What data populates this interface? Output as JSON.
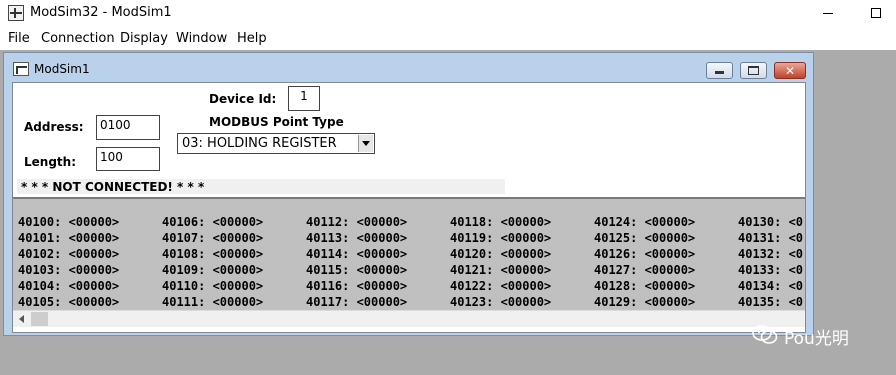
{
  "app": {
    "title": "ModSim32 - ModSim1",
    "menu": [
      "File",
      "Connection",
      "Display",
      "Window",
      "Help"
    ]
  },
  "child": {
    "title": "ModSim1",
    "address_label": "Address:",
    "address_value": "0100",
    "length_label": "Length:",
    "length_value": "100",
    "device_id_label": "Device Id:",
    "device_id_value": "1",
    "point_type_label": "MODBUS Point Type",
    "point_type_value": "03: HOLDING REGISTER",
    "status": "* * * NOT CONNECTED! * * *"
  },
  "registers": {
    "columns": [
      [
        "40100: <00000>",
        "40101: <00000>",
        "40102: <00000>",
        "40103: <00000>",
        "40104: <00000>",
        "40105: <00000>"
      ],
      [
        "40106: <00000>",
        "40107: <00000>",
        "40108: <00000>",
        "40109: <00000>",
        "40110: <00000>",
        "40111: <00000>"
      ],
      [
        "40112: <00000>",
        "40113: <00000>",
        "40114: <00000>",
        "40115: <00000>",
        "40116: <00000>",
        "40117: <00000>"
      ],
      [
        "40118: <00000>",
        "40119: <00000>",
        "40120: <00000>",
        "40121: <00000>",
        "40122: <00000>",
        "40123: <00000>"
      ],
      [
        "40124: <00000>",
        "40125: <00000>",
        "40126: <00000>",
        "40127: <00000>",
        "40128: <00000>",
        "40129: <00000>"
      ],
      [
        "40130: <0",
        "40131: <0",
        "40132: <0",
        "40133: <0",
        "40134: <0",
        "40135: <0"
      ]
    ]
  },
  "watermark": {
    "text": "Pou光明"
  },
  "colors": {
    "mdi_background": "#ababab",
    "titlebar_child": "#b9d1ea",
    "register_area": "#c0c0c0",
    "close_button": "#c1422b"
  }
}
